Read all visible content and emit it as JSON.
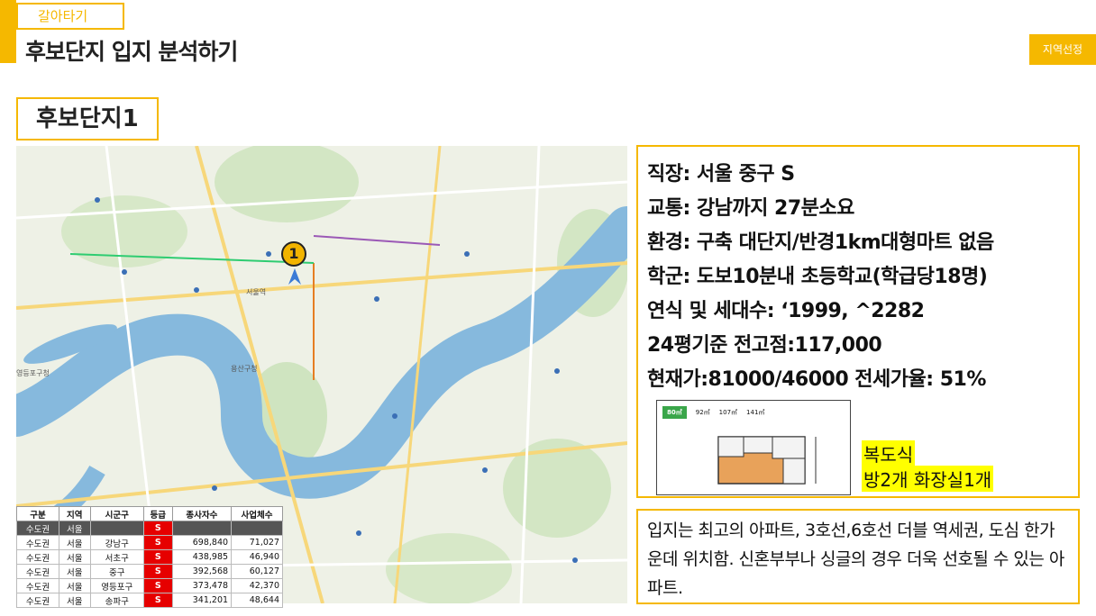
{
  "header": {
    "category": "갈아타기",
    "title": "후보단지 입지 분석하기",
    "badge": "지역선정"
  },
  "section": {
    "title": "후보단지1"
  },
  "map": {
    "marker_label": "1",
    "colors": {
      "water": "#86b9dd",
      "land": "#eef1e6",
      "park": "#cfe4c0",
      "road": "#f7d77a",
      "marker": "#f2b400"
    },
    "labels": {
      "yongsan": "용산구청",
      "yeongdeungpo": "영등포구청",
      "station": "서울역"
    }
  },
  "table": {
    "headers": [
      "구분",
      "지역",
      "시군구",
      "등급",
      "종사자수",
      "사업체수"
    ],
    "summary": {
      "cells": [
        "수도권",
        "서울",
        "",
        "S",
        "",
        ""
      ]
    },
    "rows": [
      {
        "cells": [
          "수도권",
          "서울",
          "강남구",
          "S",
          "698,840",
          "71,027"
        ]
      },
      {
        "cells": [
          "수도권",
          "서울",
          "서초구",
          "S",
          "438,985",
          "46,940"
        ]
      },
      {
        "cells": [
          "수도권",
          "서울",
          "중구",
          "S",
          "392,568",
          "60,127"
        ]
      },
      {
        "cells": [
          "수도권",
          "서울",
          "영등포구",
          "S",
          "373,478",
          "42,370"
        ]
      },
      {
        "cells": [
          "수도권",
          "서울",
          "송파구",
          "S",
          "341,201",
          "48,644"
        ]
      }
    ]
  },
  "info": {
    "lines": [
      "직장: 서울 중구 S",
      "교통: 강남까지 27분소요",
      "환경: 구축 대단지/반경1km대형마트 없음",
      "학군: 도보10분내 초등학교(학급당18명)",
      "연식 및 세대수:  ‘1999,  ^2282",
      "24평기준 전고점:117,000",
      "현재가:81000/46000   전세가율: 51%"
    ],
    "floorplan_tabs": [
      "80㎡",
      "92㎡",
      "107㎡",
      "141㎡"
    ],
    "highlight": [
      "복도식",
      "방2개 화장실1개"
    ]
  },
  "summary": {
    "text": "입지는 최고의 아파트, 3호선,6호선 더블 역세권, 도심 한가운데 위치함. 신혼부부나 싱글의 경우 더욱 선호될 수 있는 아파트."
  }
}
